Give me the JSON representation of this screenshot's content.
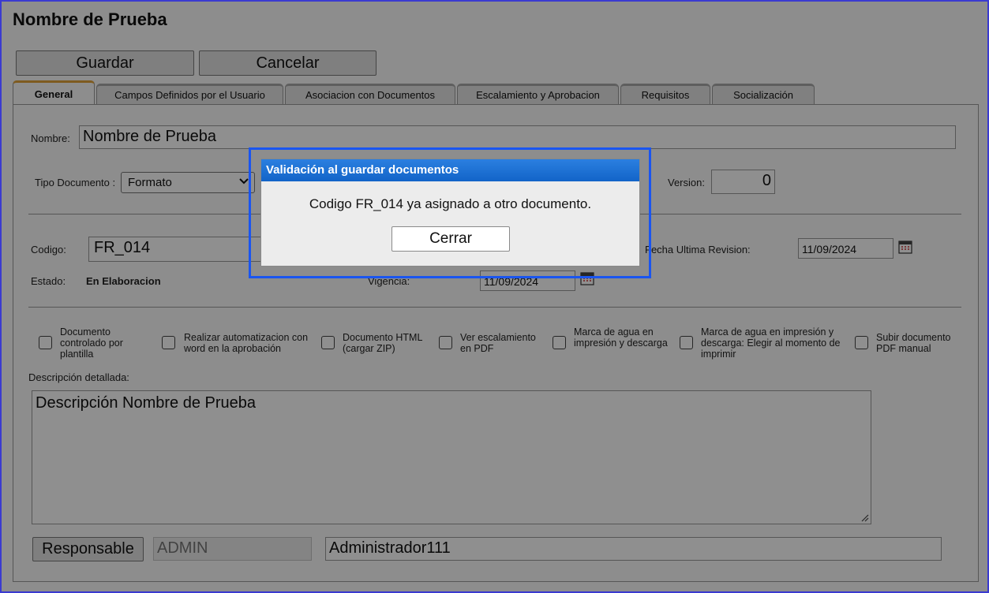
{
  "page": {
    "title": "Nombre de Prueba"
  },
  "toolbar": {
    "save_label": "Guardar",
    "cancel_label": "Cancelar"
  },
  "tabs": [
    {
      "label": "General",
      "active": true
    },
    {
      "label": "Campos Definidos por el Usuario"
    },
    {
      "label": "Asociacion con Documentos"
    },
    {
      "label": "Escalamiento y Aprobacion"
    },
    {
      "label": "Requisitos"
    },
    {
      "label": "Socialización"
    }
  ],
  "form": {
    "nombre_label": "Nombre:",
    "nombre_value": "Nombre de Prueba",
    "tipo_label": "Tipo Documento :",
    "tipo_value": "Formato",
    "version_label": "Version:",
    "version_value": "0",
    "codigo_label": "Codigo:",
    "codigo_value": "FR_014",
    "fecha_rev_label": "Fecha Ultima Revision:",
    "fecha_rev_value": "11/09/2024",
    "estado_label": "Estado:",
    "estado_value": "En Elaboracion",
    "vigencia_label": "Vigencia:",
    "vigencia_value": "11/09/2024",
    "checkboxes": [
      {
        "label": "Documento controlado por plantilla",
        "checked": false
      },
      {
        "label": "Realizar automatizacion con word en la aprobación",
        "checked": false
      },
      {
        "label": "Documento HTML (cargar ZIP)",
        "checked": false
      },
      {
        "label": "Ver escalamiento en PDF",
        "checked": false
      },
      {
        "label": "Marca de agua en impresión y descarga",
        "checked": false
      },
      {
        "label": "Marca de agua en impresión y descarga: Elegir al momento de imprimir",
        "checked": false
      },
      {
        "label": "Subir documento PDF manual",
        "checked": false
      }
    ],
    "descripcion_label": "Descripción detallada:",
    "descripcion_value": "Descripción Nombre de Prueba",
    "responsable_button": "Responsable",
    "responsable_code": "ADMIN",
    "responsable_name": "Administrador111"
  },
  "dialog": {
    "title": "Validación al guardar documentos",
    "message": "Codigo FR_014 ya asignado a otro documento.",
    "close_label": "Cerrar"
  },
  "colors": {
    "dialog_title_bg": "#1264c8",
    "highlight_border": "#1a55f0",
    "active_tab_accent": "#e0a23a",
    "frame_border": "#3a3ad0"
  }
}
